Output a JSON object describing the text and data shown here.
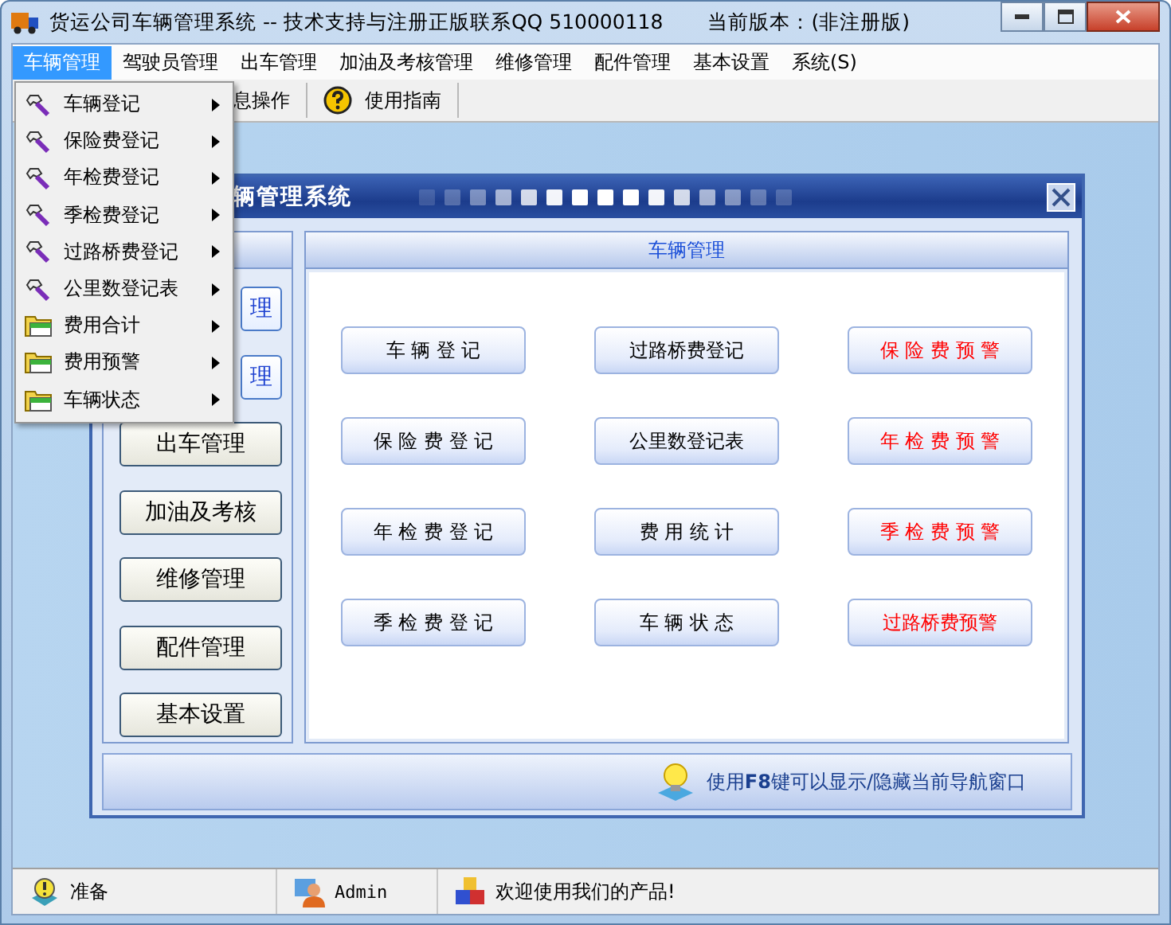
{
  "window": {
    "title": "货运公司车辆管理系统 -- 技术支持与注册正版联系QQ 510000118",
    "version": "当前版本：(非注册版)"
  },
  "menu_bar": [
    {
      "label": "车辆管理",
      "selected": true
    },
    {
      "label": "驾驶员管理",
      "selected": false
    },
    {
      "label": "出车管理",
      "selected": false
    },
    {
      "label": "加油及考核管理",
      "selected": false
    },
    {
      "label": "维修管理",
      "selected": false
    },
    {
      "label": "配件管理",
      "selected": false
    },
    {
      "label": "基本设置",
      "selected": false
    },
    {
      "label": "系统(S)",
      "selected": false
    }
  ],
  "dropdown": [
    {
      "label": "车辆登记",
      "kind": "tool"
    },
    {
      "label": "保险费登记",
      "kind": "tool"
    },
    {
      "label": "年检费登记",
      "kind": "tool"
    },
    {
      "label": "季检费登记",
      "kind": "tool"
    },
    {
      "label": "过路桥费登记",
      "kind": "tool"
    },
    {
      "label": "公里数登记表",
      "kind": "tool"
    },
    {
      "label": "费用合计",
      "kind": "folder"
    },
    {
      "label": "费用预警",
      "kind": "folder"
    },
    {
      "label": "车辆状态",
      "kind": "folder"
    }
  ],
  "toolbar": [
    {
      "label": "息操作",
      "kind": "text"
    },
    {
      "label": "使用指南",
      "kind": "help"
    }
  ],
  "inner_window": {
    "title": "辆管理系统",
    "nav_buttons": [
      "理",
      "理",
      "出车管理",
      "加油及考核",
      "维修管理",
      "配件管理",
      "基本设置"
    ],
    "content_header": "车辆管理",
    "actions": [
      {
        "label": "车 辆 登 记",
        "warning": false
      },
      {
        "label": "过路桥费登记",
        "warning": false
      },
      {
        "label": "保 险 费 预 警",
        "warning": true
      },
      {
        "label": "保 险 费 登 记",
        "warning": false
      },
      {
        "label": "公里数登记表",
        "warning": false
      },
      {
        "label": "年 检 费 预 警",
        "warning": true
      },
      {
        "label": "年 检 费 登 记",
        "warning": false
      },
      {
        "label": "费 用 统 计",
        "warning": false
      },
      {
        "label": "季 检 费 预 警",
        "warning": true
      },
      {
        "label": "季 检 费 登 记",
        "warning": false
      },
      {
        "label": "车 辆 状 态",
        "warning": false
      },
      {
        "label": "过路桥费预警",
        "warning": true
      }
    ],
    "hint": "使用**F8**键可以显示/隐藏当前导航窗口"
  },
  "status_bar": [
    {
      "kind": "ready",
      "text": "准备"
    },
    {
      "kind": "user",
      "text": "Admin"
    },
    {
      "kind": "welcome",
      "text": "欢迎使用我们的产品!"
    }
  ]
}
